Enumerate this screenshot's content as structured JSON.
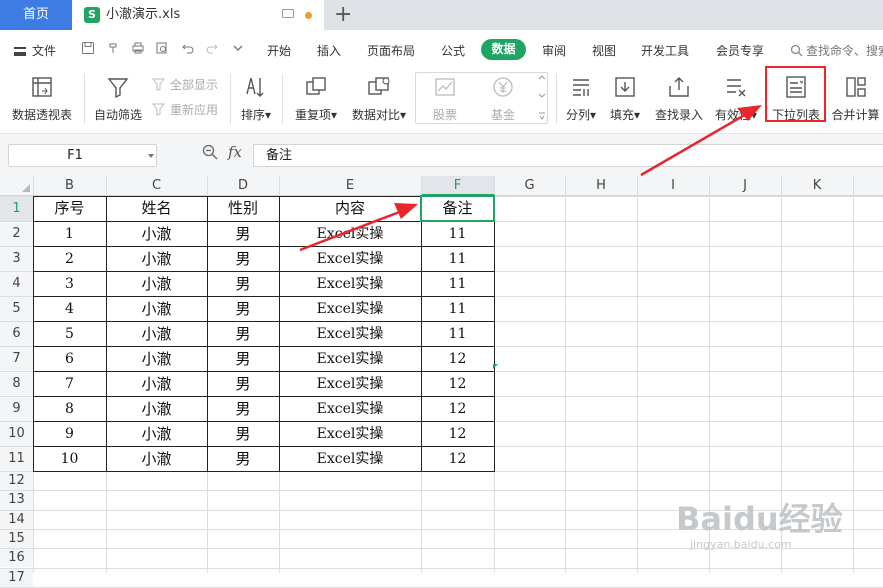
{
  "tabs": {
    "home": "首页",
    "file_icon": "S",
    "file_name": "小澈演示.xls",
    "new_tab": "+"
  },
  "menu": {
    "file": "文件",
    "items": [
      "开始",
      "插入",
      "页面布局",
      "公式",
      "数据",
      "审阅",
      "视图",
      "开发工具",
      "会员专享"
    ],
    "active": "数据",
    "search": "查找命令、搜索"
  },
  "ribbon": {
    "pivot": "数据透视表",
    "autofilter": "自动筛选",
    "show_all": "全部显示",
    "reapply": "重新应用",
    "sort": "排序",
    "duplicates": "重复项",
    "compare": "数据对比",
    "stock": "股票",
    "fund": "基金",
    "split": "分列",
    "fill": "填充",
    "lookup": "查找录入",
    "validity": "有效性",
    "dropdown": "下拉列表",
    "consolidate": "合并计算"
  },
  "formula_bar": {
    "name_box": "F1",
    "fx": "fx",
    "content": "备注"
  },
  "grid": {
    "columns": [
      "B",
      "C",
      "D",
      "E",
      "F",
      "G",
      "H",
      "I",
      "J",
      "K"
    ],
    "rows": [
      "1",
      "2",
      "3",
      "4",
      "5",
      "6",
      "7",
      "8",
      "9",
      "10",
      "11",
      "12",
      "13",
      "14",
      "15",
      "16",
      "17"
    ],
    "header": [
      "序号",
      "姓名",
      "性别",
      "内容",
      "备注"
    ],
    "data": [
      [
        "1",
        "小澈",
        "男",
        "Excel实操",
        "11"
      ],
      [
        "2",
        "小澈",
        "男",
        "Excel实操",
        "11"
      ],
      [
        "3",
        "小澈",
        "男",
        "Excel实操",
        "11"
      ],
      [
        "4",
        "小澈",
        "男",
        "Excel实操",
        "11"
      ],
      [
        "5",
        "小澈",
        "男",
        "Excel实操",
        "11"
      ],
      [
        "6",
        "小澈",
        "男",
        "Excel实操",
        "12"
      ],
      [
        "7",
        "小澈",
        "男",
        "Excel实操",
        "12"
      ],
      [
        "8",
        "小澈",
        "男",
        "Excel实操",
        "12"
      ],
      [
        "9",
        "小澈",
        "男",
        "Excel实操",
        "12"
      ],
      [
        "10",
        "小澈",
        "男",
        "Excel实操",
        "12"
      ]
    ],
    "selected_cell": "F1"
  },
  "watermark": {
    "text": "Baidu经验",
    "sub": "jingyan.baidu.com"
  },
  "colors": {
    "accent_green": "#1fa463",
    "home_blue": "#3d7ce3",
    "arrow_red": "#e8262c"
  }
}
